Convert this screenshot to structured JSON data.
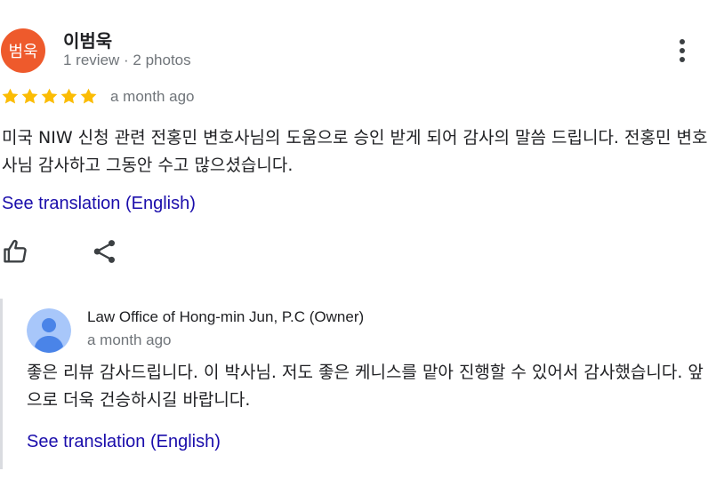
{
  "review": {
    "avatar_text": "범욱",
    "avatar_color": "#ee5a2c",
    "reviewer_name": "이범욱",
    "reviewer_meta": "1 review · 2 photos",
    "more_icon": "more-vert-icon",
    "rating": 5,
    "rating_max": 5,
    "star_color": "#fbbc04",
    "date": "a month ago",
    "text": "미국 NIW 신청 관련 전홍민 변호사님의 도움으로 승인 받게 되어 감사의 말씀 드립니다. 전홍민 변호사님 감사하고 그동안 수고 많으셨습니다.",
    "translation_link": "See translation (English)",
    "actions": {
      "like_icon": "thumb-up-icon",
      "share_icon": "share-icon"
    }
  },
  "owner_response": {
    "avatar_icon": "default-profile-icon",
    "name": "Law Office of Hong-min Jun, P.C (Owner)",
    "date": "a month ago",
    "text": "좋은 리뷰 감사드립니다. 이 박사님. 저도 좋은 케니스를 맡아 진행할 수 있어서 감사했습니다. 앞으로 더욱 건승하시길 바랍니다.",
    "translation_link": "See translation (English)"
  },
  "colors": {
    "link": "#1a0dab",
    "secondary_text": "#70757a",
    "divider": "#dadce0"
  }
}
